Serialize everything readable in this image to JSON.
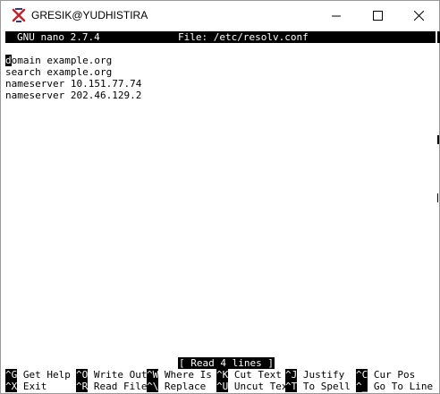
{
  "window": {
    "title": "GRESIK@YUDHISTIRA"
  },
  "nano": {
    "version": "GNU nano 2.7.4",
    "file_label": "File: /etc/resolv.conf",
    "lines": [
      {
        "first": "d",
        "rest": "omain example.org"
      },
      {
        "first": "",
        "rest": "search example.org"
      },
      {
        "first": "",
        "rest": "nameserver 10.151.77.74"
      },
      {
        "first": "",
        "rest": "nameserver 202.46.129.2"
      }
    ],
    "status": "[ Read 4 lines ]",
    "shortcuts_row1": [
      {
        "key": "^G",
        "label": " Get Help"
      },
      {
        "key": "^O",
        "label": " Write Out"
      },
      {
        "key": "^W",
        "label": " Where Is"
      },
      {
        "key": "^K",
        "label": " Cut Text"
      },
      {
        "key": "^J",
        "label": " Justify"
      },
      {
        "key": "^C",
        "label": " Cur Pos"
      }
    ],
    "shortcuts_row2": [
      {
        "key": "^X",
        "label": " Exit"
      },
      {
        "key": "^R",
        "label": " Read File"
      },
      {
        "key": "^\\",
        "label": " Replace"
      },
      {
        "key": "^U",
        "label": " Uncut Text"
      },
      {
        "key": "^T",
        "label": " To Spell"
      },
      {
        "key": "^_",
        "label": " Go To Line"
      }
    ]
  }
}
